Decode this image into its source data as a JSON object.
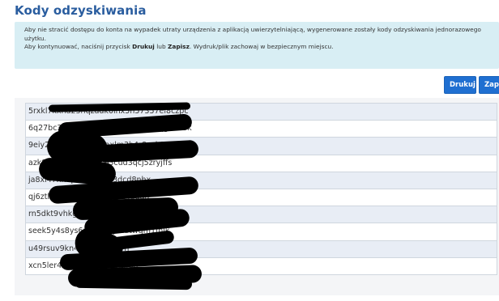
{
  "page": {
    "title": "Kody odzyskiwania"
  },
  "alert": {
    "line1": "Aby nie stracić dostępu do konta na wypadek utraty urządzenia z aplikacją uwierzytelniającą, wygenerowane zostały kody odzyskiwania jednorazowego",
    "line1b": "użytku.",
    "line2_pre": "Aby kontynuować, naciśnij przycisk ",
    "line2_print": "Drukuj",
    "line2_mid": " lub ",
    "line2_save": "Zapisz",
    "line2_post": ". Wydruk/plik zachowaj w bezpiecznym miejscu."
  },
  "actions": {
    "print_label": "Drukuj",
    "save_label": "Zapisz"
  },
  "codes": [
    "5rxkl7kxna23nqzadk0lhx5n57357ei8czpc",
    "6q27bc3gxnrm8kxc06ewkl0lnp0eqgbc15k",
    "9eiy27kx0aoxnwcmaxlm3h4r8sok9",
    "azk8kl3fh8xzv6sk5lb3cud3qcj5zryjffs",
    "ja8xl47xn6pn0lb9rfgk3dcd8nhx",
    "qj6ztlll8r2n6m1xgugge27faqaj2",
    "rn5dkt9vhkg8r4v0xbnkmqhsgjoi",
    "seek5y4s8ys6m8n9xq7aatwqm1mik",
    "u49rsuv9kn4rxzgla5nt9vn",
    "xcn5ler4zhsw5vxnb4c0fxrsn"
  ]
}
